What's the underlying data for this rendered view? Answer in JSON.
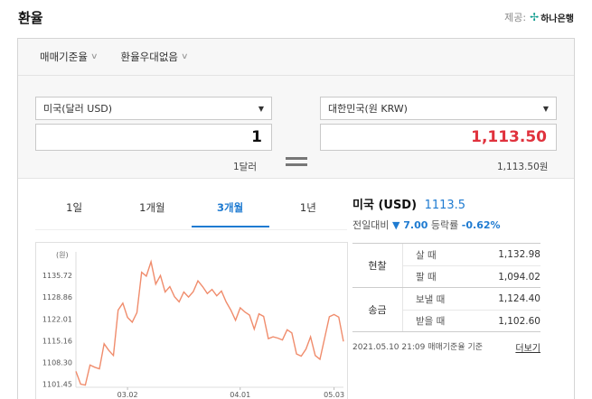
{
  "header": {
    "title": "환율",
    "provider_label": "제공:",
    "provider_name": "하나은행"
  },
  "options": {
    "base_rate": "매매기준율",
    "no_discount": "환율우대없음"
  },
  "converter": {
    "from_currency": "미국(달러 USD)",
    "to_currency": "대한민국(원 KRW)",
    "from_amount": "1",
    "to_amount": "1,113.50",
    "from_text": "1달러",
    "to_text": "1,113.50원"
  },
  "tabs": [
    "1일",
    "1개월",
    "3개월",
    "1년"
  ],
  "info": {
    "currency": "미국 (USD)",
    "rate": "1113.5",
    "prev_label": "전일대비",
    "change": "▼ 7.00",
    "ratio_label": "등락률",
    "ratio": "-0.62%"
  },
  "rates": {
    "cash": {
      "label": "현찰",
      "buy_label": "살 때",
      "buy": "1,132.98",
      "sell_label": "팔 때",
      "sell": "1,094.02"
    },
    "remit": {
      "label": "송금",
      "send_label": "보낼 때",
      "send": "1,124.40",
      "receive_label": "받을 때",
      "receive": "1,102.60"
    }
  },
  "footer": {
    "timestamp": "2021.05.10 21:09",
    "basis": "매매기준율 기준",
    "more": "더보기"
  },
  "chart_data": {
    "type": "line",
    "unit_label": "(원)",
    "y_ticks": [
      1101.45,
      1108.3,
      1115.16,
      1122.01,
      1128.86,
      1135.72
    ],
    "x_ticks": [
      "03.02",
      "04.01",
      "05.03"
    ],
    "ylim": [
      1100.5,
      1142
    ],
    "line_color": "#f08c6c",
    "values": [
      1105.5,
      1101.5,
      1101.2,
      1107.5,
      1106.8,
      1106.3,
      1114.2,
      1112.1,
      1110.5,
      1124.8,
      1127.0,
      1122.5,
      1121.0,
      1124.0,
      1136.7,
      1135.5,
      1140.0,
      1133.0,
      1135.7,
      1130.5,
      1132.2,
      1129.0,
      1127.4,
      1130.5,
      1128.9,
      1130.6,
      1134.0,
      1132.2,
      1130.0,
      1131.3,
      1129.3,
      1130.8,
      1127.4,
      1124.8,
      1121.6,
      1125.5,
      1124.2,
      1123.2,
      1118.8,
      1123.6,
      1122.8,
      1115.8,
      1116.4,
      1116.0,
      1115.4,
      1118.6,
      1117.6,
      1111.0,
      1110.3,
      1112.5,
      1116.4,
      1110.5,
      1109.3,
      1116.0,
      1122.7,
      1123.4,
      1122.6,
      1114.9
    ],
    "x_tick_index": [
      11,
      35,
      55
    ]
  }
}
